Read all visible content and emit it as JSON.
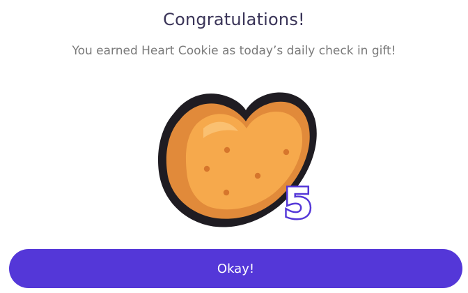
{
  "dialog": {
    "title": "Congratulations!",
    "subtitle": "You earned Heart Cookie as today’s daily check in gift!",
    "reward": {
      "icon": "heart-cookie-icon",
      "quantity": "5"
    },
    "okay_button_label": "Okay!"
  },
  "colors": {
    "primary_button": "#5437d8",
    "title_text": "#3a3458",
    "subtitle_text": "#7a7a7a",
    "cookie_body": "#f6a94c",
    "cookie_shade": "#e18a3a",
    "cookie_outline": "#1f1c22",
    "quantity_fill": "#ffffff",
    "quantity_stroke": "#5437d8"
  }
}
